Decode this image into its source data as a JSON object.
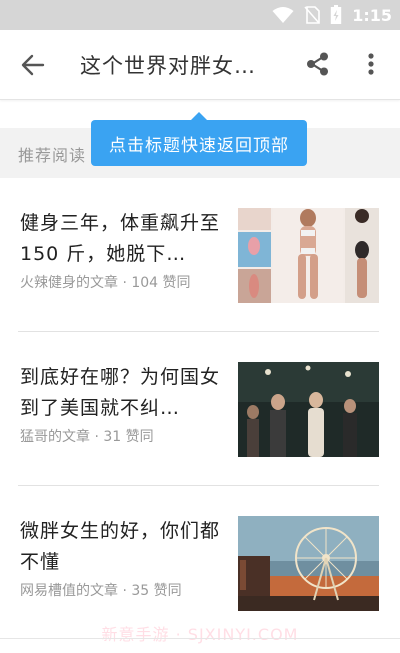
{
  "status_bar": {
    "time": "1:15"
  },
  "app_bar": {
    "title": "这个世界对胖女…"
  },
  "section": {
    "title": "推荐阅读"
  },
  "tooltip": {
    "text": "点击标题快速返回顶部"
  },
  "articles": [
    {
      "title": "健身三年，体重飙升至 150 斤，她脱下…",
      "meta": "火辣健身的文章 · 104 赞同"
    },
    {
      "title": "到底好在哪？为何国女到了美国就不纠…",
      "meta": "猛哥的文章 · 31 赞同"
    },
    {
      "title": "微胖女生的好，你们都不懂",
      "meta": "网易槽值的文章 · 35 赞同"
    }
  ],
  "watermark": {
    "text": "新意手游 · SJXINYI.COM"
  },
  "colors": {
    "accent": "#3aa3f2",
    "status_bar": "#d6d6d6",
    "section_bg": "#f2f2f2"
  }
}
